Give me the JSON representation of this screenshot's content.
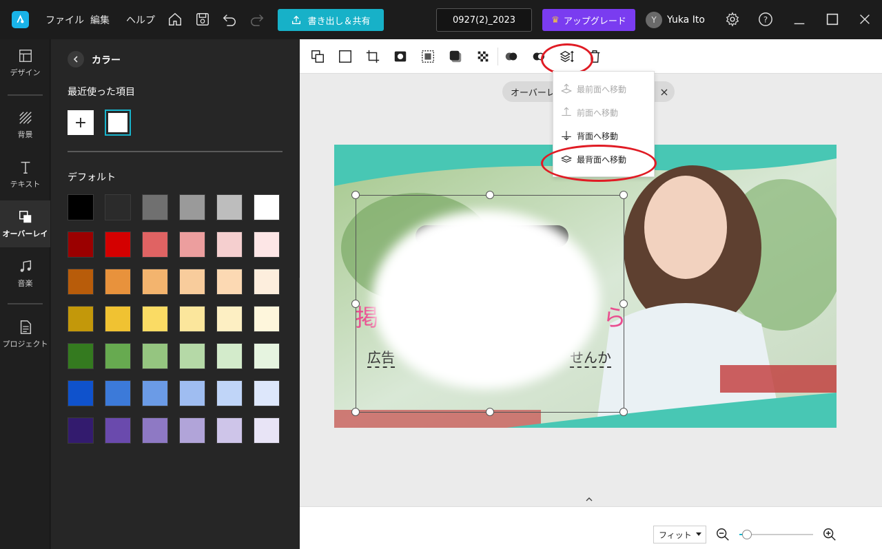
{
  "titlebar": {
    "menus": [
      "ファイル",
      "編集",
      "ヘルプ"
    ],
    "export_label": "書き出し＆共有",
    "project_name": "0927(2)_2023",
    "upgrade_label": "アップグレード",
    "avatar_initial": "Y",
    "username": "Yuka Ito"
  },
  "leftnav": {
    "items": [
      {
        "label": "デザイン",
        "icon": "layout-icon"
      },
      {
        "label": "背景",
        "icon": "background-icon"
      },
      {
        "label": "テキスト",
        "icon": "text-icon"
      },
      {
        "label": "オーバーレイ",
        "icon": "overlay-icon",
        "active": true
      },
      {
        "label": "音楽",
        "icon": "music-icon"
      },
      {
        "label": "プロジェクト",
        "icon": "project-icon"
      }
    ]
  },
  "panel": {
    "title": "カラー",
    "recent_label": "最近使った項目",
    "add_label": "+",
    "default_label": "デフォルト",
    "recent_colors": [
      "#ffffff"
    ],
    "swatches": [
      [
        "#000000",
        "#2b2b2b",
        "#707070",
        "#9a9a9a",
        "#bdbdbd",
        "#ffffff"
      ],
      [
        "#9b0000",
        "#d40000",
        "#e06363",
        "#ec9e9e",
        "#f5cfcf",
        "#fde6e6"
      ],
      [
        "#b85c0a",
        "#e8923c",
        "#f3b46e",
        "#f8cc9c",
        "#fcd9b3",
        "#fdeedd"
      ],
      [
        "#c3980a",
        "#f0c232",
        "#fadb64",
        "#fbe69c",
        "#fdefc3",
        "#fef6dc"
      ],
      [
        "#347a1f",
        "#67aa50",
        "#95c580",
        "#b5d9a7",
        "#d3ebcb",
        "#e6f4e0"
      ],
      [
        "#0f52cc",
        "#3c7ad9",
        "#6b9be6",
        "#9fbdf1",
        "#c0d5f8",
        "#dde7fb"
      ],
      [
        "#331b6e",
        "#6a4aad",
        "#8e79c4",
        "#b1a4d9",
        "#cec5e9",
        "#e8e4f6"
      ]
    ]
  },
  "toolbar": {
    "tools": [
      "replace-icon",
      "rectangle-icon",
      "crop-icon",
      "mask-icon",
      "border-icon",
      "shadow-icon",
      "transparency-icon",
      "blend-icon",
      "flip-icon",
      "arrange-icon",
      "delete-icon"
    ]
  },
  "chip": {
    "label": "オーバーレイ",
    "close": "×"
  },
  "arrange_menu": {
    "items": [
      {
        "label": "最前面へ移動",
        "enabled": false
      },
      {
        "label": "前面へ移動",
        "enabled": false
      },
      {
        "label": "背面へ移動",
        "enabled": true
      },
      {
        "label": "最背面へ移動",
        "enabled": true
      }
    ]
  },
  "canvas": {
    "text_big_left": "掲",
    "text_big_right": "ら",
    "text_small_left": "広告",
    "text_small_right": "せんか"
  },
  "bottombar": {
    "fit_label": "フィット",
    "zoom_level": 0.1
  },
  "colors": {
    "accent": "#17b1c8",
    "upgrade": "#7a3cf0",
    "highlight": "#e01b24",
    "canvas_bg": "#48c7b4"
  }
}
